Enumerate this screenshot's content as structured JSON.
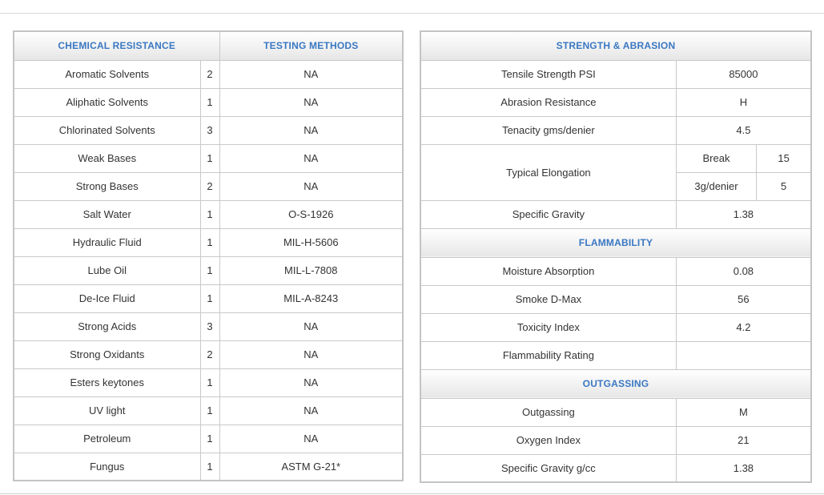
{
  "left": {
    "headers": {
      "chemical": "CHEMICAL RESISTANCE",
      "testing": "TESTING METHODS"
    },
    "rows": [
      {
        "name": "Aromatic Solvents",
        "rating": "2",
        "method": "NA"
      },
      {
        "name": "Aliphatic Solvents",
        "rating": "1",
        "method": "NA"
      },
      {
        "name": "Chlorinated Solvents",
        "rating": "3",
        "method": "NA"
      },
      {
        "name": "Weak Bases",
        "rating": "1",
        "method": "NA"
      },
      {
        "name": "Strong Bases",
        "rating": "2",
        "method": "NA"
      },
      {
        "name": "Salt Water",
        "rating": "1",
        "method": "O-S-1926"
      },
      {
        "name": "Hydraulic Fluid",
        "rating": "1",
        "method": "MIL-H-5606"
      },
      {
        "name": "Lube Oil",
        "rating": "1",
        "method": "MIL-L-7808"
      },
      {
        "name": "De-Ice Fluid",
        "rating": "1",
        "method": "MIL-A-8243"
      },
      {
        "name": "Strong Acids",
        "rating": "3",
        "method": "NA"
      },
      {
        "name": "Strong Oxidants",
        "rating": "2",
        "method": "NA"
      },
      {
        "name": "Esters keytones",
        "rating": "1",
        "method": "NA"
      },
      {
        "name": "UV light",
        "rating": "1",
        "method": "NA"
      },
      {
        "name": "Petroleum",
        "rating": "1",
        "method": "NA"
      },
      {
        "name": "Fungus",
        "rating": "1",
        "method": "ASTM G-21*"
      }
    ]
  },
  "right": {
    "strength_header": "STRENGTH & ABRASION",
    "tensile": {
      "label": "Tensile Strength PSI",
      "value": "85000"
    },
    "abrasion": {
      "label": "Abrasion Resistance",
      "value": "H"
    },
    "tenacity": {
      "label": "Tenacity gms/denier",
      "value": "4.5"
    },
    "elongation": {
      "label": "Typical Elongation",
      "break_label": "Break",
      "break_value": "15",
      "denier_label": "3g/denier",
      "denier_value": "5"
    },
    "specific_gravity": {
      "label": "Specific Gravity",
      "value": "1.38"
    },
    "flammability_header": "FLAMMABILITY",
    "moisture": {
      "label": "Moisture Absorption",
      "value": "0.08"
    },
    "smoke": {
      "label": "Smoke D-Max",
      "value": "56"
    },
    "toxicity": {
      "label": "Toxicity Index",
      "value": "4.2"
    },
    "flam_rating": {
      "label": "Flammability Rating",
      "value": ""
    },
    "outgassing_header": "OUTGASSING",
    "outgassing": {
      "label": "Outgassing",
      "value": "M"
    },
    "oxygen": {
      "label": "Oxygen Index",
      "value": "21"
    },
    "sg_cc": {
      "label": "Specific Gravity g/cc",
      "value": "1.38"
    }
  }
}
